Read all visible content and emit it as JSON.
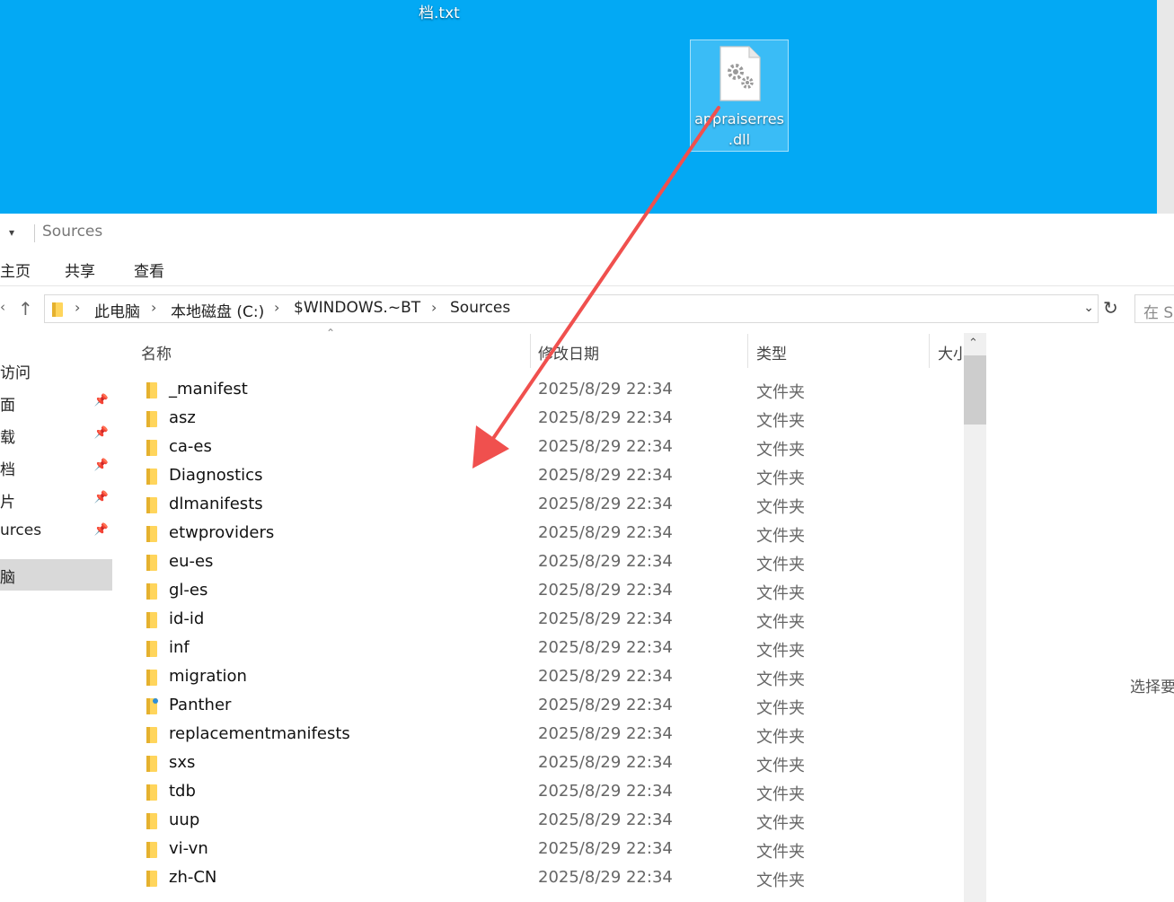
{
  "desktop": {
    "top_label": "档.txt",
    "selected_icon": {
      "name": "appraiserres\n.dll",
      "icon": "dll-file-gear-icon"
    }
  },
  "window": {
    "title": "Sources",
    "tabs": [
      "主页",
      "共享",
      "查看"
    ],
    "breadcrumbs": [
      "此电脑",
      "本地磁盘 (C:)",
      "$WINDOWS.~BT",
      "Sources"
    ],
    "search_placeholder": "在 S"
  },
  "nav": {
    "items": [
      {
        "label": "访问",
        "pinned": false
      },
      {
        "label": "面",
        "pinned": true
      },
      {
        "label": "载",
        "pinned": true
      },
      {
        "label": "档",
        "pinned": true
      },
      {
        "label": "片",
        "pinned": true
      },
      {
        "label": "urces",
        "pinned": true
      },
      {
        "label": "脑",
        "pinned": false,
        "selected": true
      }
    ]
  },
  "columns": {
    "name": "名称",
    "date": "修改日期",
    "type": "类型",
    "size": "大小"
  },
  "files": [
    {
      "name": "_manifest",
      "date": "2025/8/29 22:34",
      "type": "文件夹",
      "icon": "folder-icon"
    },
    {
      "name": "asz",
      "date": "2025/8/29 22:34",
      "type": "文件夹",
      "icon": "folder-icon"
    },
    {
      "name": "ca-es",
      "date": "2025/8/29 22:34",
      "type": "文件夹",
      "icon": "folder-icon"
    },
    {
      "name": "Diagnostics",
      "date": "2025/8/29 22:34",
      "type": "文件夹",
      "icon": "folder-icon"
    },
    {
      "name": "dlmanifests",
      "date": "2025/8/29 22:34",
      "type": "文件夹",
      "icon": "folder-icon"
    },
    {
      "name": "etwproviders",
      "date": "2025/8/29 22:34",
      "type": "文件夹",
      "icon": "folder-icon"
    },
    {
      "name": "eu-es",
      "date": "2025/8/29 22:34",
      "type": "文件夹",
      "icon": "folder-icon"
    },
    {
      "name": "gl-es",
      "date": "2025/8/29 22:34",
      "type": "文件夹",
      "icon": "folder-icon"
    },
    {
      "name": "id-id",
      "date": "2025/8/29 22:34",
      "type": "文件夹",
      "icon": "folder-icon"
    },
    {
      "name": "inf",
      "date": "2025/8/29 22:34",
      "type": "文件夹",
      "icon": "folder-icon"
    },
    {
      "name": "migration",
      "date": "2025/8/29 22:34",
      "type": "文件夹",
      "icon": "folder-icon"
    },
    {
      "name": "Panther",
      "date": "2025/8/29 22:34",
      "type": "文件夹",
      "icon": "folder-special-icon"
    },
    {
      "name": "replacementmanifests",
      "date": "2025/8/29 22:34",
      "type": "文件夹",
      "icon": "folder-icon"
    },
    {
      "name": "sxs",
      "date": "2025/8/29 22:34",
      "type": "文件夹",
      "icon": "folder-icon"
    },
    {
      "name": "tdb",
      "date": "2025/8/29 22:34",
      "type": "文件夹",
      "icon": "folder-icon"
    },
    {
      "name": "uup",
      "date": "2025/8/29 22:34",
      "type": "文件夹",
      "icon": "folder-icon"
    },
    {
      "name": "vi-vn",
      "date": "2025/8/29 22:34",
      "type": "文件夹",
      "icon": "folder-icon"
    },
    {
      "name": "zh-CN",
      "date": "2025/8/29 22:34",
      "type": "文件夹",
      "icon": "folder-icon"
    }
  ],
  "details_hint": "选择要",
  "colors": {
    "desktop": "#03a9f4",
    "folder": "#ffd55c",
    "annotation": "#f0504e"
  }
}
